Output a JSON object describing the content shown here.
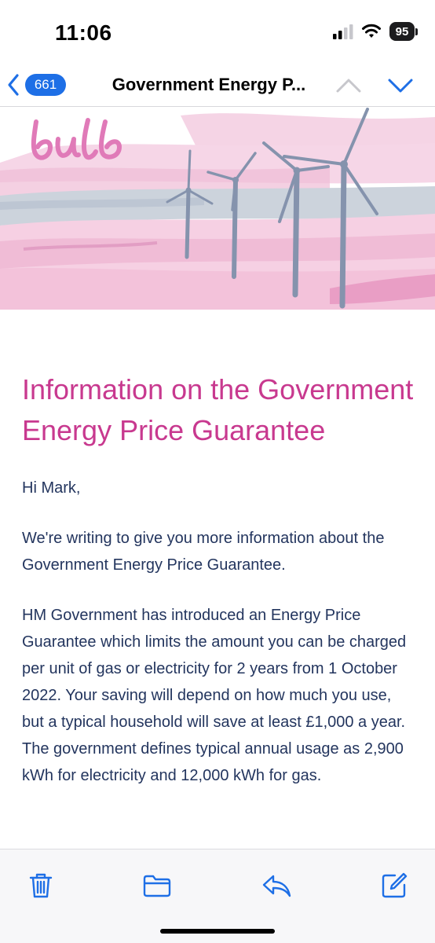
{
  "status_bar": {
    "time": "11:06",
    "battery_level": "95",
    "icons": [
      "cellular-signal-icon",
      "wifi-icon",
      "battery-icon"
    ]
  },
  "nav": {
    "back_icon": "chevron-left-icon",
    "unread_count": "661",
    "title": "Government Energy P...",
    "prev_icon": "chevron-up-icon",
    "next_icon": "chevron-down-icon"
  },
  "hero": {
    "brand": "bulb",
    "illustration": "wind-turbines-pink-landscape",
    "colors": {
      "brand_pink": "#e07ab8",
      "turbine": "#8593ad",
      "water": "#ccd3dc"
    }
  },
  "email": {
    "heading": "Information on the Government Energy Price Guarantee",
    "paragraphs": [
      "Hi Mark,",
      "We're writing to give you more information about the Government Energy Price Guarantee.",
      "HM Government has introduced an Energy Price Guarantee which limits the amount you can be charged per unit of gas or electricity for 2 years from 1 October 2022. Your saving will depend on how much you use, but a typical household will save at least £1,000 a year. The government defines typical annual usage as 2,900 kWh for electricity and 12,000 kWh for gas."
    ],
    "colors": {
      "heading": "#c8398f",
      "body": "#23355e"
    }
  },
  "toolbar": {
    "buttons": [
      "trash-icon",
      "folder-icon",
      "reply-icon",
      "compose-icon"
    ],
    "accent": "#1e6fe6"
  }
}
